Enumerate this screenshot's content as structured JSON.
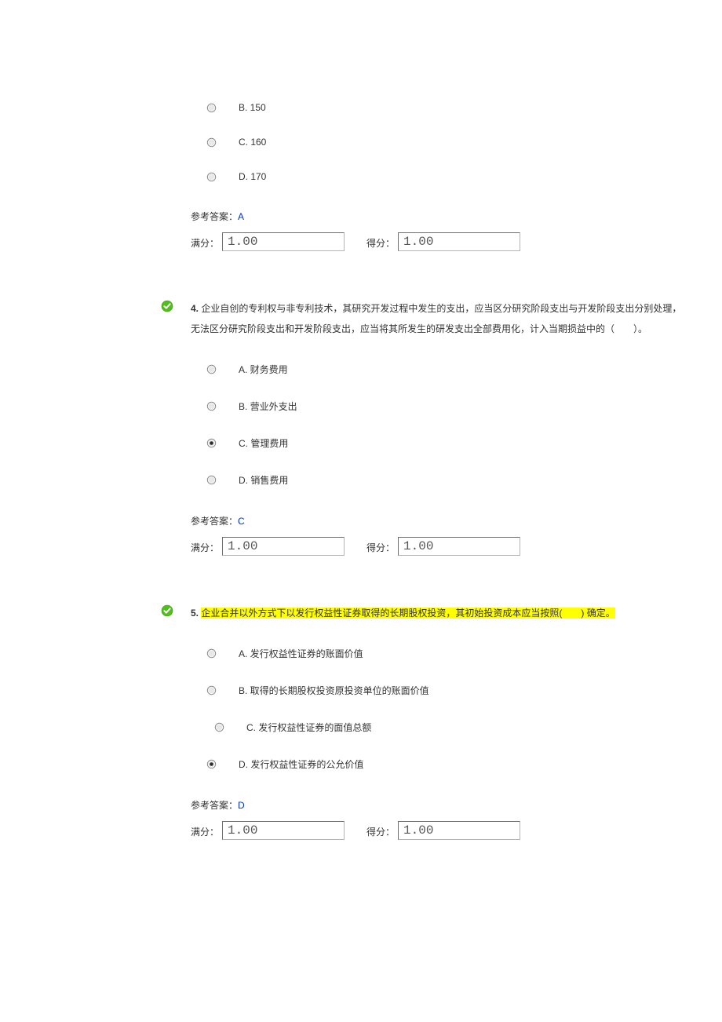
{
  "q3": {
    "options": [
      {
        "label": "B. 150",
        "selected": false
      },
      {
        "label": "C. 160",
        "selected": false
      },
      {
        "label": "D. 170",
        "selected": false
      }
    ],
    "answer_label": "参考答案：",
    "answer_value": "A",
    "full_label": "满分：",
    "full_value": "1.00",
    "score_label": "得分：",
    "score_value": "1.00"
  },
  "q4": {
    "number": "4.",
    "stem_a": "企业自创的专利权与非专利技术，其研究开发过程中发生的支出，应当区分研究阶段支出与开发阶段支出分别处理，",
    "stem_b": "无法区分研究阶段支出和开发阶段支出，应当将其所发生的研发支出全部费用化，计入当期损益中的（　　）。",
    "options": [
      {
        "label": "A. 财务费用",
        "selected": false
      },
      {
        "label": "B. 营业外支出",
        "selected": false
      },
      {
        "label": "C. 管理费用",
        "selected": true
      },
      {
        "label": "D. 销售费用",
        "selected": false
      }
    ],
    "answer_label": "参考答案：",
    "answer_value": "C",
    "full_label": "满分：",
    "full_value": "1.00",
    "score_label": "得分：",
    "score_value": "1.00"
  },
  "q5": {
    "number": "5.",
    "stem_hl": "企业合并以外方式下以发行权益性证券取得的长期股权投资，其初始投资成本应当按照(　　) 确定。",
    "options": [
      {
        "label": "A. 发行权益性证券的账面价值",
        "selected": false
      },
      {
        "label": "B. 取得的长期股权投资原投资单位的账面价值",
        "selected": false
      },
      {
        "label": "C. 发行权益性证券的面值总额",
        "selected": false
      },
      {
        "label": "D. 发行权益性证券的公允价值",
        "selected": true
      }
    ],
    "answer_label": "参考答案：",
    "answer_value": "D",
    "full_label": "满分：",
    "full_value": "1.00",
    "score_label": "得分：",
    "score_value": "1.00"
  }
}
